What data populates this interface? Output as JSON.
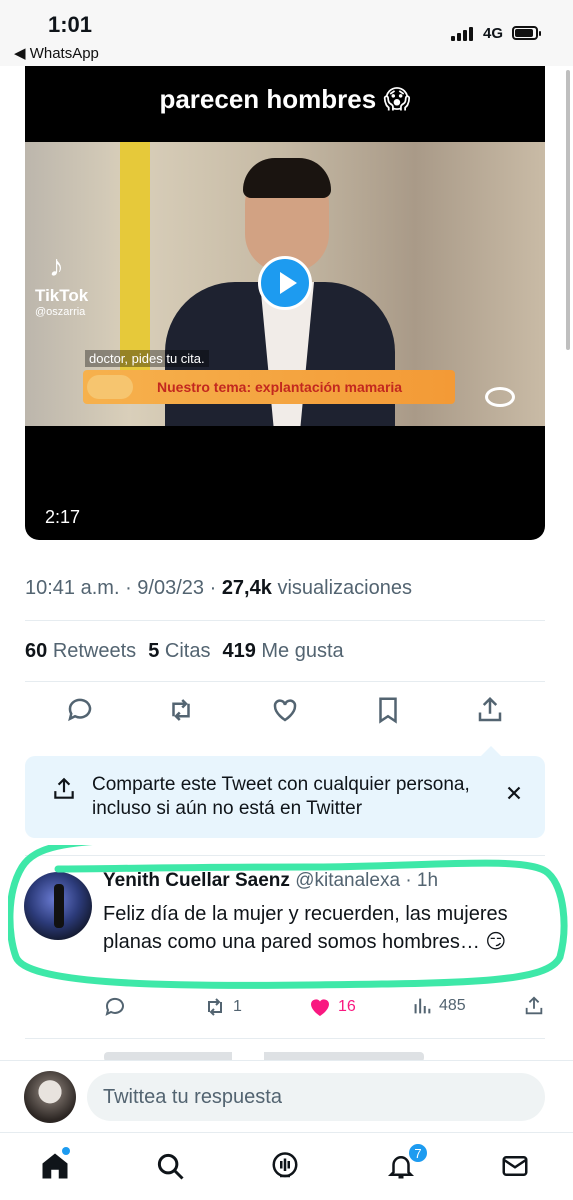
{
  "status_bar": {
    "time": "1:01",
    "back_app": "◀ WhatsApp",
    "network": "4G"
  },
  "video": {
    "caption": "parecen hombres 😱",
    "tiktok_name": "TikTok",
    "tiktok_user": "@oszarria",
    "subtitle": "doctor, pides tu cita.",
    "banner": "Nuestro tema: explantación mamaria",
    "duration": "2:17"
  },
  "tweet_meta": {
    "time": "10:41 a.m.",
    "date": "9/03/23",
    "views_count": "27,4k",
    "views_label": "visualizaciones"
  },
  "stats": {
    "retweets_count": "60",
    "retweets_label": "Retweets",
    "quotes_count": "5",
    "quotes_label": "Citas",
    "likes_count": "419",
    "likes_label": "Me gusta"
  },
  "share_card": {
    "text": "Comparte este Tweet con cualquier persona, incluso si aún no está en Twitter"
  },
  "reply": {
    "name": "Yenith Cuellar Saenz",
    "handle": "@kitanalexa",
    "time": "· 1h",
    "text": "Feliz día de la mujer y recuerden, las mujeres planas como una pared somos hombres… 😏",
    "retweets": "1",
    "likes": "16",
    "views": "485",
    "like_color": "#f91880"
  },
  "compose": {
    "placeholder": "Twittea tu respuesta"
  },
  "tabbar": {
    "notifications_badge": "7"
  },
  "colors": {
    "accent": "#1d9bf0",
    "highlight": "#3ee8a8"
  }
}
